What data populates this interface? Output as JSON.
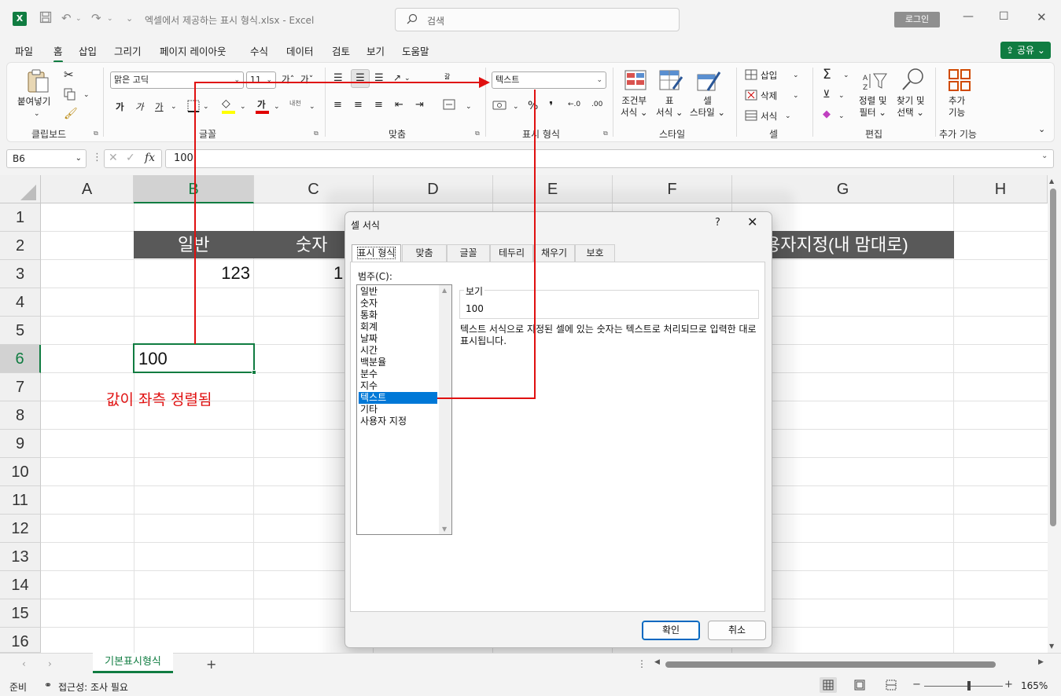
{
  "titlebar": {
    "app_icon": "X",
    "window_title": "엑셀에서 제공하는 표시 형식.xlsx  -  Excel",
    "search_placeholder": "검색",
    "login_label": "로그인"
  },
  "menu": {
    "tabs": [
      "파일",
      "홈",
      "삽입",
      "그리기",
      "페이지 레이아웃",
      "수식",
      "데이터",
      "검토",
      "보기",
      "도움말"
    ],
    "active": "홈",
    "share_label": "공유"
  },
  "ribbon": {
    "clipboard": {
      "paste_label": "붙여넣기",
      "group_label": "클립보드"
    },
    "font": {
      "font_name": "맑은 고딕",
      "font_size": "11",
      "bold": "가",
      "italic": "가",
      "underline": "가",
      "font_color_glyph": "가",
      "phonetic": "내천",
      "grow": "가ˆ",
      "shrink": "가ˇ",
      "group_label": "글꼴"
    },
    "alignment": {
      "wrap_glyph": "갊",
      "group_label": "맞춤"
    },
    "number": {
      "format_value": "텍스트",
      "percent": "%",
      "comma": "❜",
      "inc_decimal": "←.0",
      "dec_decimal": ".00",
      "group_label": "표시 형식"
    },
    "styles": {
      "conditional_label": [
        "조건부",
        "서식 ⌄"
      ],
      "table_label": [
        "표",
        "서식 ⌄"
      ],
      "cell_style_label": [
        "셀",
        "스타일 ⌄"
      ],
      "group_label": "스타일"
    },
    "cells": {
      "insert_label": "삽입",
      "delete_label": "삭제",
      "format_label": "서식",
      "group_label": "셀"
    },
    "editing": {
      "sort_label": [
        "정렬 및",
        "필터 ⌄"
      ],
      "find_label": [
        "찾기 및",
        "선택 ⌄"
      ],
      "group_label": "편집"
    },
    "addins": {
      "label": [
        "추가",
        "기능"
      ],
      "group_label": "추가 기능"
    }
  },
  "formula_bar": {
    "name_box": "B6",
    "fx": "fx",
    "value": "100"
  },
  "grid": {
    "columns": [
      "A",
      "B",
      "C",
      "D",
      "E",
      "F",
      "G",
      "H"
    ],
    "rows": [
      "1",
      "2",
      "3",
      "4",
      "5",
      "6",
      "7",
      "8",
      "9",
      "10",
      "11",
      "12",
      "13",
      "14",
      "15",
      "16"
    ],
    "header_row": {
      "b": "일반",
      "c": "숫자",
      "g": "용자지정(내 맘대로)"
    },
    "b3": "123",
    "c3": "1",
    "b6": "100"
  },
  "annotation": {
    "text": "값이 좌측 정렬됨",
    "color": "#e01010"
  },
  "dialog": {
    "title": "셀 서식",
    "help": "?",
    "close": "✕",
    "tabs": [
      "표시 형식",
      "맞춤",
      "글꼴",
      "테두리",
      "채우기",
      "보호"
    ],
    "active_tab": "표시 형식",
    "category_label": "범주(C):",
    "categories": [
      "일반",
      "숫자",
      "통화",
      "회계",
      "날짜",
      "시간",
      "백분율",
      "분수",
      "지수",
      "텍스트",
      "기타",
      "사용자 지정"
    ],
    "selected_category": "텍스트",
    "preview_label": "보기",
    "preview_value": "100",
    "description": "텍스트 서식으로 지정된 셀에 있는 숫자는 텍스트로 처리되므로 입력한 대로 표시됩니다.",
    "ok_label": "확인",
    "cancel_label": "취소"
  },
  "sheet_tabs": {
    "active_sheet": "기본표시형식",
    "add": "+"
  },
  "status_bar": {
    "ready": "준비",
    "accessibility": "접근성: 조사 필요",
    "zoom": "165%"
  },
  "colors": {
    "excel_green": "#107c41",
    "header_band": "#595959",
    "selection_blue": "#0078d7",
    "annotation_red": "#e01010"
  }
}
